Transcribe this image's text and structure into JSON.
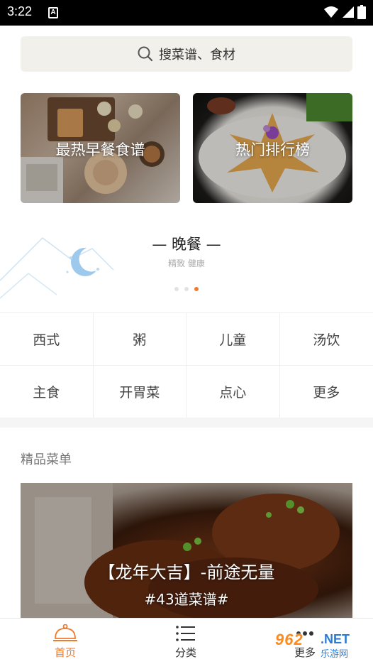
{
  "status_bar": {
    "time": "3:22",
    "badge": "A"
  },
  "search": {
    "placeholder": "搜菜谱、食材"
  },
  "cards": [
    {
      "label": "最热早餐食谱"
    },
    {
      "label": "热门排行榜"
    }
  ],
  "banner": {
    "title": "— 晚餐 —",
    "subtitle": "精致 健康",
    "dots_total": 3,
    "dots_active_index": 2
  },
  "categories": [
    "西式",
    "粥",
    "儿童",
    "汤饮",
    "主食",
    "开胃菜",
    "点心",
    "更多"
  ],
  "premium": {
    "section_title": "精品菜单",
    "feature_title": "【龙年大吉】-前途无量",
    "feature_subtitle": "#43道菜谱#"
  },
  "bottom_nav": [
    {
      "label": "首页",
      "icon": "cloche-icon",
      "active": true
    },
    {
      "label": "分类",
      "icon": "list-icon",
      "active": false
    },
    {
      "label": "更多",
      "icon": "more-icon",
      "active": false
    }
  ],
  "watermark": {
    "number": "962",
    "net": ".NET",
    "sub": "乐游网"
  },
  "colors": {
    "accent": "#f07b2d",
    "search_bg": "#f2f0eb",
    "divider": "#eeeeee"
  }
}
